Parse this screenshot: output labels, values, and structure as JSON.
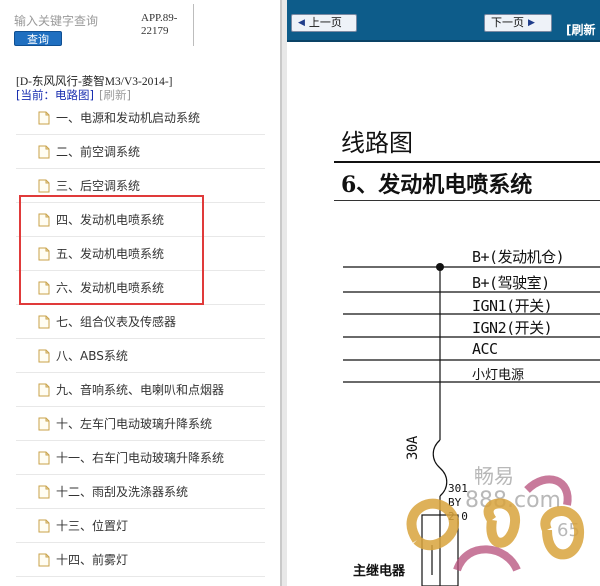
{
  "search": {
    "placeholder": "输入关键字查询",
    "button_label": "查询",
    "app_code": "APP.89-\n22179"
  },
  "model": {
    "title": "[D-东风风行-菱智M3/V3-2014-]",
    "current_label": "[当前：电路图]",
    "refresh_label": "[刷新]"
  },
  "toc": [
    {
      "label": "一、电源和发动机启动系统"
    },
    {
      "label": "二、前空调系统"
    },
    {
      "label": "三、后空调系统"
    },
    {
      "label": "四、发动机电喷系统"
    },
    {
      "label": "五、发动机电喷系统"
    },
    {
      "label": "六、发动机电喷系统"
    },
    {
      "label": "七、组合仪表及传感器"
    },
    {
      "label": "八、ABS系统"
    },
    {
      "label": "九、音响系统、电喇叭和点烟器"
    },
    {
      "label": "十、左车门电动玻璃升降系统"
    },
    {
      "label": "十一、右车门电动玻璃升降系统"
    },
    {
      "label": "十二、雨刮及洗涤器系统"
    },
    {
      "label": "十三、位置灯"
    },
    {
      "label": "十四、前雾灯"
    }
  ],
  "viewer": {
    "prev_label": "上一页",
    "next_label": "下一页",
    "refresh_label": "[刷新"
  },
  "diagram": {
    "title": "线路图",
    "subtitle": "6、发动机电喷系统",
    "buses": [
      "B+(发动机仓)",
      "B+(驾驶室)",
      "IGN1(开关)",
      "IGN2(开关)",
      "ACC",
      "小灯电源"
    ],
    "fuse": "30A",
    "wire_code": "301",
    "wire_color": "BY",
    "wire_size": "2.0",
    "relay_label": "主继电器"
  },
  "watermark": {
    "text1": "畅易",
    "text2": "888.com",
    "text3": "65"
  },
  "colors": {
    "highlight_box": "#e03a3a",
    "topbar": "#0d5c8a",
    "search_button": "#1f6fc0",
    "current_label": "#1a2fb0"
  }
}
